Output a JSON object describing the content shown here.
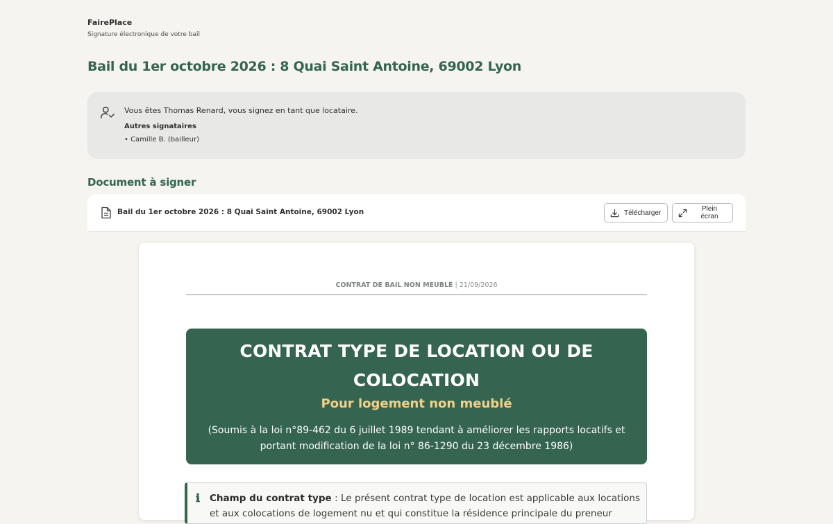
{
  "app": {
    "name": "FairePlace",
    "subtitle": "Signature électronique de votre bail"
  },
  "page": {
    "title": "Bail du 1er octobre 2026 : 8 Quai Saint Antoine, 69002 Lyon"
  },
  "signer": {
    "you_text": "Vous êtes Thomas Renard, vous signez en tant que locataire.",
    "others_title": "Autres signataires",
    "others": [
      "• Camille B. (bailleur)"
    ],
    "icon": "user-check-icon"
  },
  "document_section": {
    "title": "Document à signer",
    "file_name": "Bail du 1er octobre 2026 : 8 Quai Saint Antoine, 69002 Lyon",
    "download_label": "Télécharger",
    "fullscreen_label": "Plein écran"
  },
  "preview": {
    "header_type": "CONTRAT DE BAIL NON MEUBLÉ",
    "header_sep": " | ",
    "header_date": "21/09/2026",
    "banner_title": "CONTRAT TYPE DE LOCATION OU DE COLOCATION",
    "banner_subtitle": "Pour logement non meublé",
    "banner_law": "(Soumis à la loi n°89-462 du 6 juillet 1989 tendant à améliorer les rapports locatifs et portant modification de la loi n° 86-1290 du 23 décembre 1986)",
    "info_label": "Champ du contrat type",
    "info_text": " : Le présent contrat type de location est applicable aux locations et aux colocations de logement nu et qui constitue la résidence principale du preneur"
  },
  "colors": {
    "accent": "#356451",
    "banner_subtitle": "#f1d08a",
    "background": "#f5f4f0"
  }
}
